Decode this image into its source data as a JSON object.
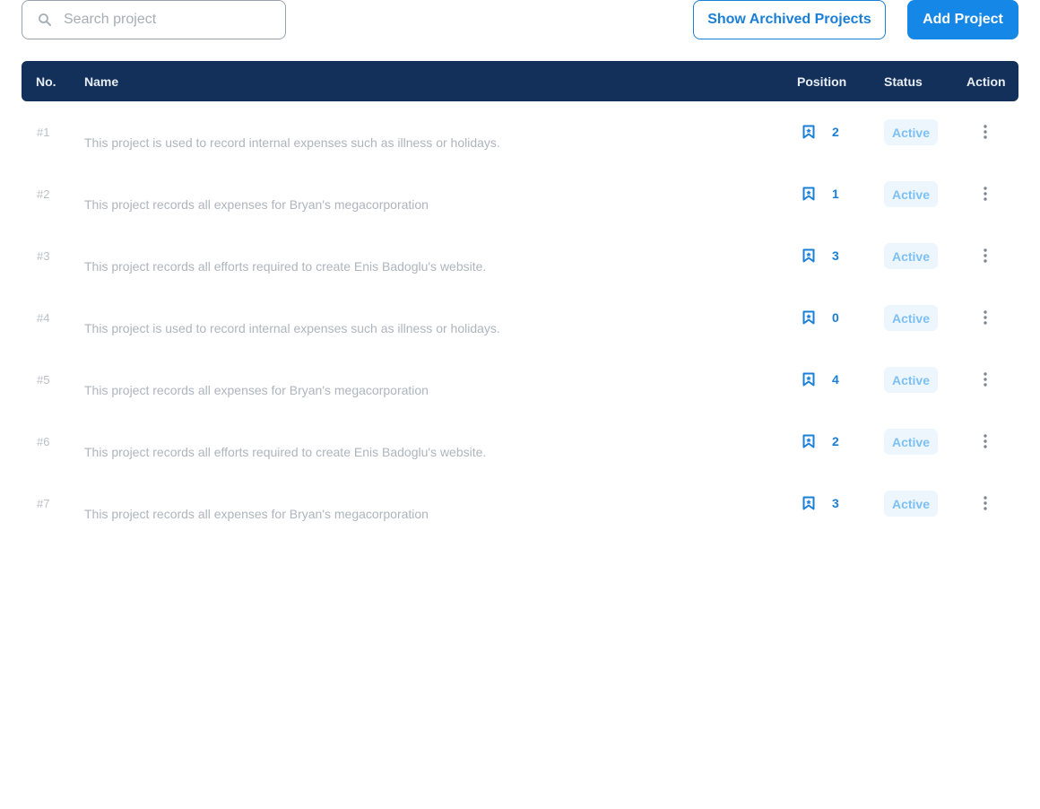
{
  "toolbar": {
    "search": {
      "placeholder": "Search project",
      "value": "",
      "icon": "search-icon"
    },
    "show_archived_label": "Show Archived Projects",
    "add_project_label": "Add Project"
  },
  "colors": {
    "header_bg": "#13305a",
    "primary": "#1587e6",
    "accent_text": "#1a7fd6",
    "badge_bg": "#eef6fd",
    "badge_text": "#7cc0f4"
  },
  "table": {
    "headers": {
      "no": "No.",
      "name": "Name",
      "position": "Position",
      "status": "Status",
      "action": "Action"
    },
    "rows": [
      {
        "no": "#1",
        "name": "This project is used to record internal expenses such as illness or holidays.",
        "position": "2",
        "status": "Active"
      },
      {
        "no": "#2",
        "name": "This project records all expenses for Bryan's megacorporation",
        "position": "1",
        "status": "Active"
      },
      {
        "no": "#3",
        "name": "This project records all efforts required to create Enis Badoglu's website.",
        "position": "3",
        "status": "Active"
      },
      {
        "no": "#4",
        "name": "This project is used to record internal expenses such as illness or holidays.",
        "position": "0",
        "status": "Active"
      },
      {
        "no": "#5",
        "name": "This project records all expenses for Bryan's megacorporation",
        "position": "4",
        "status": "Active"
      },
      {
        "no": "#6",
        "name": "This project records all efforts required to create Enis Badoglu's website.",
        "position": "2",
        "status": "Active"
      },
      {
        "no": "#7",
        "name": "This project records all expenses for Bryan's megacorporation",
        "position": "3",
        "status": "Active"
      }
    ]
  }
}
